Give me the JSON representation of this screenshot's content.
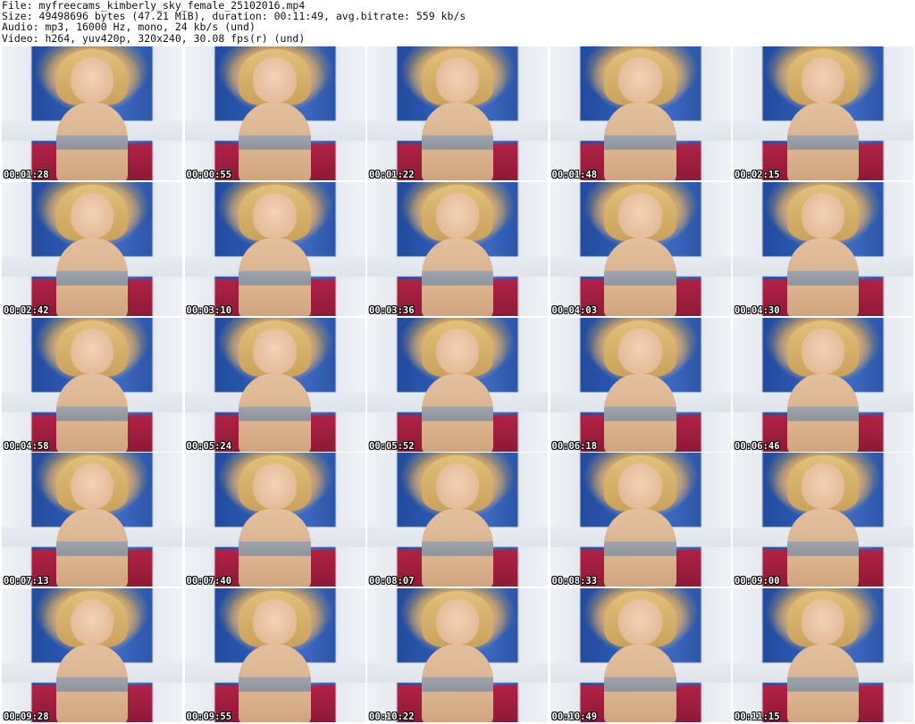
{
  "header": {
    "lines": [
      "File: myfreecams_kimberly_sky_female_25102016.mp4",
      "Size: 49498696 bytes (47.21 MiB), duration: 00:11:49, avg.bitrate: 559 kb/s",
      "Audio: mp3, 16000 Hz, mono, 24 kb/s (und)",
      "Video: h264, yuv420p, 320x240, 30.08 fps(r) (und)"
    ]
  },
  "thumbnails": [
    "00:01:28",
    "00:00:55",
    "00:01:22",
    "00:01:48",
    "00:02:15",
    "00:02:42",
    "00:03:10",
    "00:03:36",
    "00:04:03",
    "00:04:30",
    "00:04:58",
    "00:05:24",
    "00:05:52",
    "00:06:18",
    "00:06:46",
    "00:07:13",
    "00:07:40",
    "00:08:07",
    "00:08:33",
    "00:09:00",
    "00:09:28",
    "00:09:55",
    "00:10:22",
    "00:10:49",
    "00:11:15"
  ]
}
